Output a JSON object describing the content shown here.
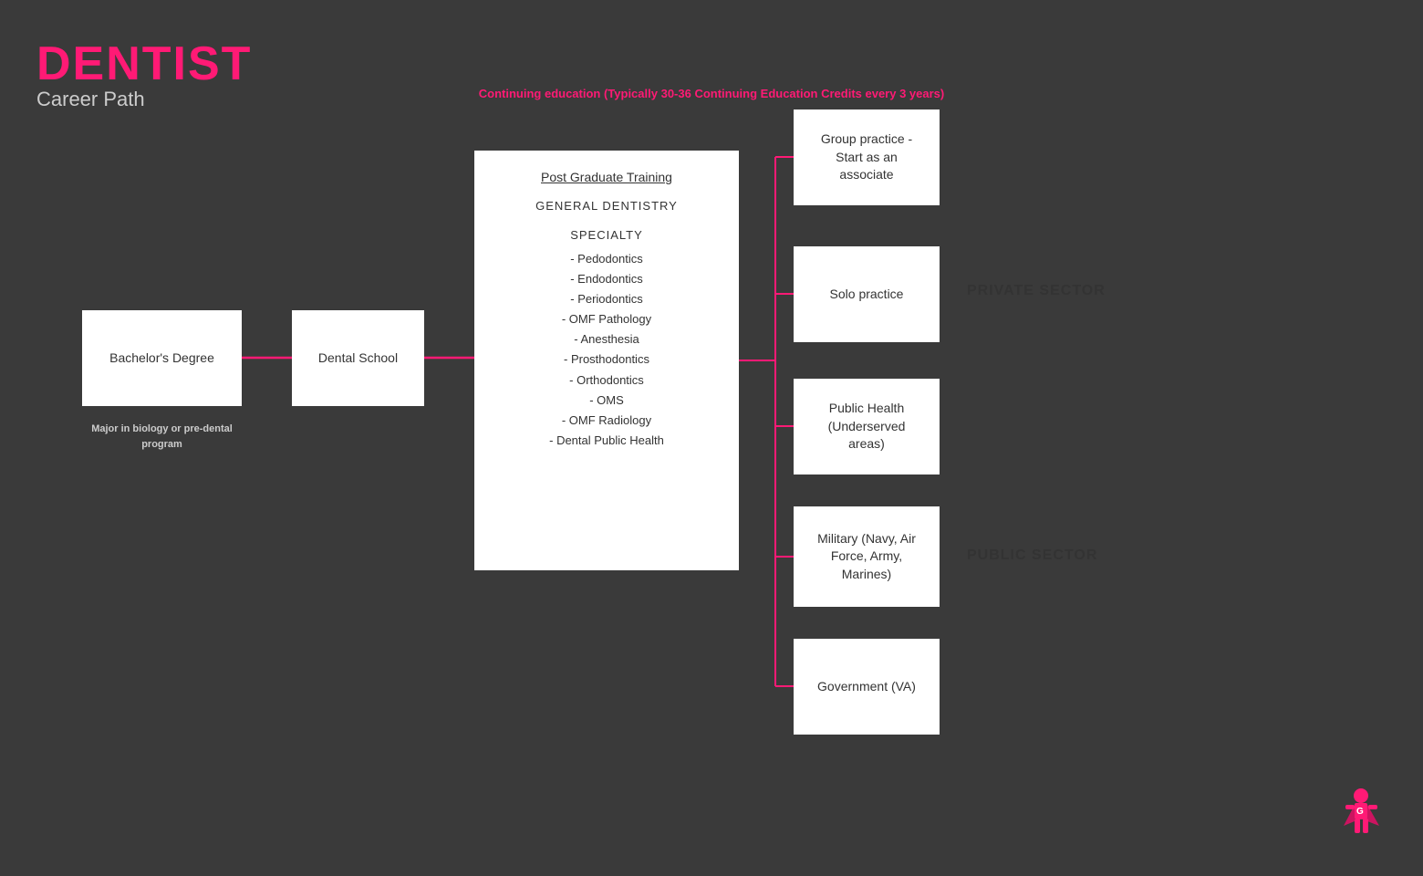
{
  "title": {
    "main": "DENTIST",
    "sub": "Career Path"
  },
  "continuing_ed": "Continuing education (Typically 30-36 Continuing Education Credits every 3 years)",
  "boxes": {
    "bachelor": "Bachelor's Degree",
    "dental_school": "Dental School",
    "postgrad": {
      "title": "Post Graduate Training",
      "general": "GENERAL DENTISTRY",
      "specialty_title": "SPECIALTY",
      "items": [
        "- Pedodontics",
        "- Endodontics",
        "- Periodontics",
        "- OMF Pathology",
        "- Anesthesia",
        "- Prosthodontics",
        "- Orthodontics",
        "- OMS",
        "- OMF Radiology",
        "- Dental Public Health"
      ]
    },
    "group_practice": "Group practice -\nStart as an\nassociate",
    "solo_practice": "Solo practice",
    "public_health": "Public Health\n(Underserved\nareas)",
    "military": "Military (Navy, Air\nForce, Army,\nMarines)",
    "government": "Government (VA)"
  },
  "sectors": {
    "private": "PRIVATE SECTOR",
    "public": "PUBLIC SECTOR"
  },
  "bachelor_note": "Major in biology or\npre-dental program",
  "colors": {
    "pink": "#ff1a75",
    "dark_bg": "#3a3a3a",
    "white": "#ffffff",
    "text_dark": "#333333",
    "text_light": "#cccccc"
  }
}
